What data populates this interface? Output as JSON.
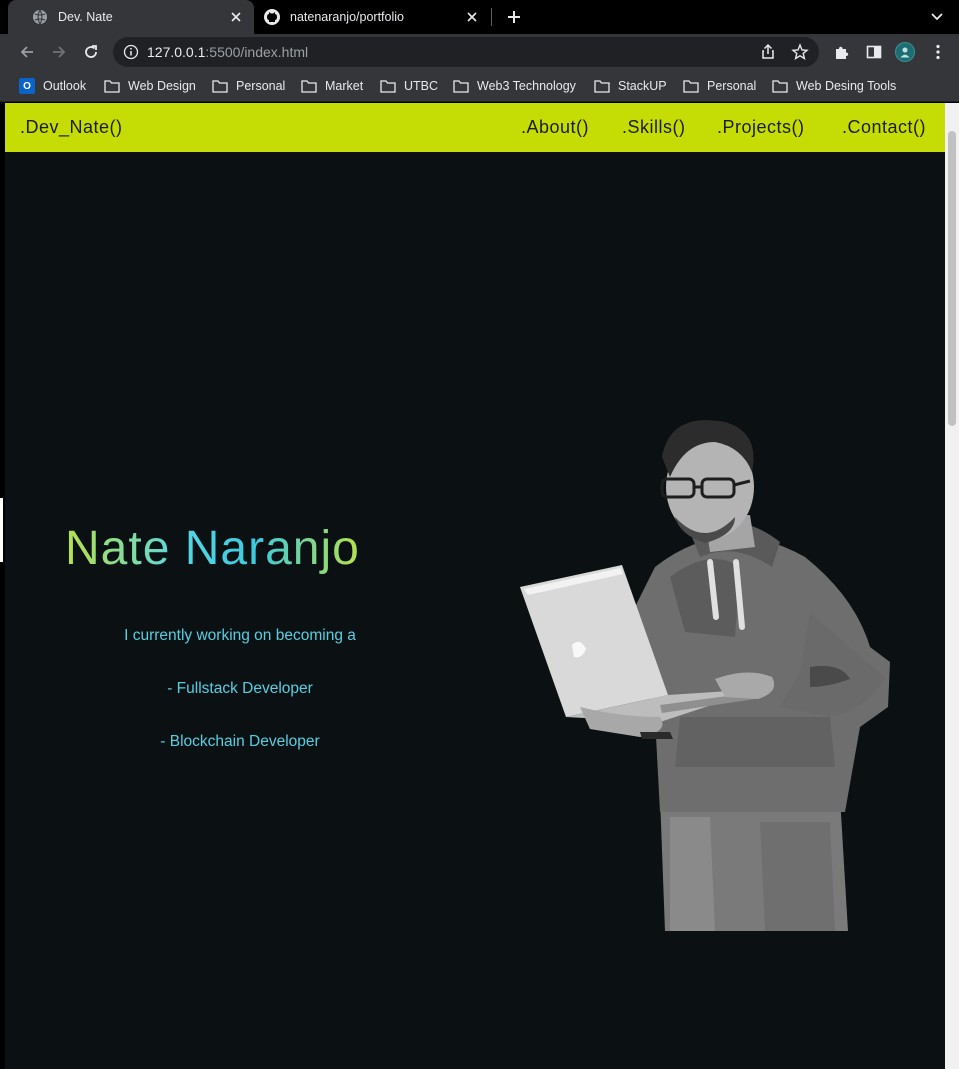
{
  "browser": {
    "tabs": [
      {
        "title": "Dev. Nate",
        "active": true,
        "favicon": "globe-icon"
      },
      {
        "title": "natenaranjo/portfolio",
        "active": false,
        "favicon": "github-icon"
      }
    ],
    "url_host": "127.0.0.1",
    "url_rest": ":5500/index.html",
    "bookmarks": [
      {
        "label": "Outlook",
        "icon": "outlook-icon"
      },
      {
        "label": "Web Design",
        "icon": "folder-icon"
      },
      {
        "label": "Personal",
        "icon": "folder-icon"
      },
      {
        "label": "Market",
        "icon": "folder-icon"
      },
      {
        "label": "UTBC",
        "icon": "folder-icon"
      },
      {
        "label": "Web3 Technology",
        "icon": "folder-icon"
      },
      {
        "label": "StackUP",
        "icon": "folder-icon"
      },
      {
        "label": "Personal",
        "icon": "folder-icon"
      },
      {
        "label": "Web Desing Tools",
        "icon": "folder-icon"
      }
    ]
  },
  "site": {
    "brand": ".Dev_Nate()",
    "nav": [
      ".About()",
      ".Skills()",
      ".Projects()",
      ".Contact()"
    ],
    "hero": {
      "name": "Nate Naranjo",
      "lines": [
        "I currently working on becoming a",
        "- Fullstack Developer",
        "- Blockchain Developer"
      ]
    }
  },
  "colors": {
    "nav_bg": "#c6dc05",
    "page_bg": "#0b1112",
    "accent_cyan": "#57cfe3",
    "accent_lime": "#b6e24b"
  }
}
